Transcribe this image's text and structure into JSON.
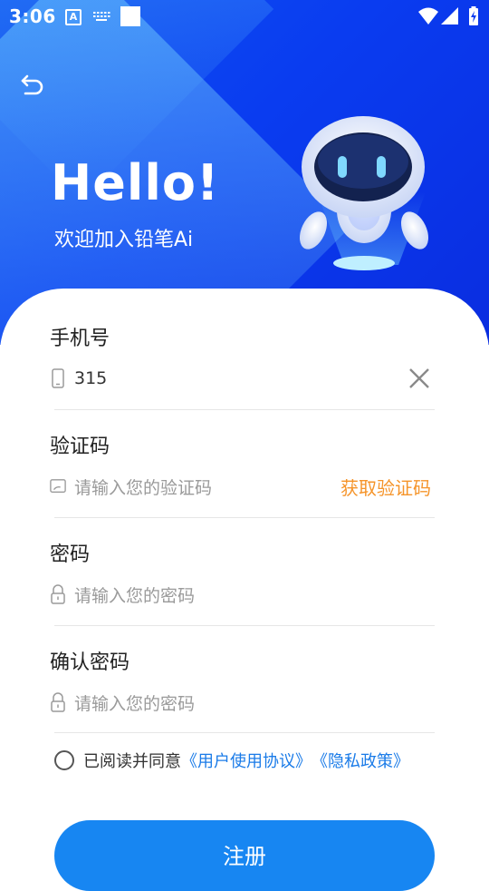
{
  "status_bar": {
    "time": "3:06",
    "a_icon_letter": "A"
  },
  "header": {
    "title": "Hello!",
    "subtitle": "欢迎加入铅笔Ai"
  },
  "form": {
    "phone": {
      "label": "手机号",
      "value": "315"
    },
    "code": {
      "label": "验证码",
      "placeholder": "请输入您的验证码",
      "get_code_label": "获取验证码"
    },
    "password": {
      "label": "密码",
      "placeholder": "请输入您的密码"
    },
    "confirm": {
      "label": "确认密码",
      "placeholder": "请输入您的密码"
    }
  },
  "agreement": {
    "text": "已阅读并同意",
    "user_link": "《用户使用协议》",
    "privacy_link": "《隐私政策》"
  },
  "register_label": "注册",
  "colors": {
    "hero_blue": "#0a3cf0",
    "accent_orange": "#f5942a",
    "link_blue": "#1a7be8",
    "button_blue": "#1786f2"
  }
}
